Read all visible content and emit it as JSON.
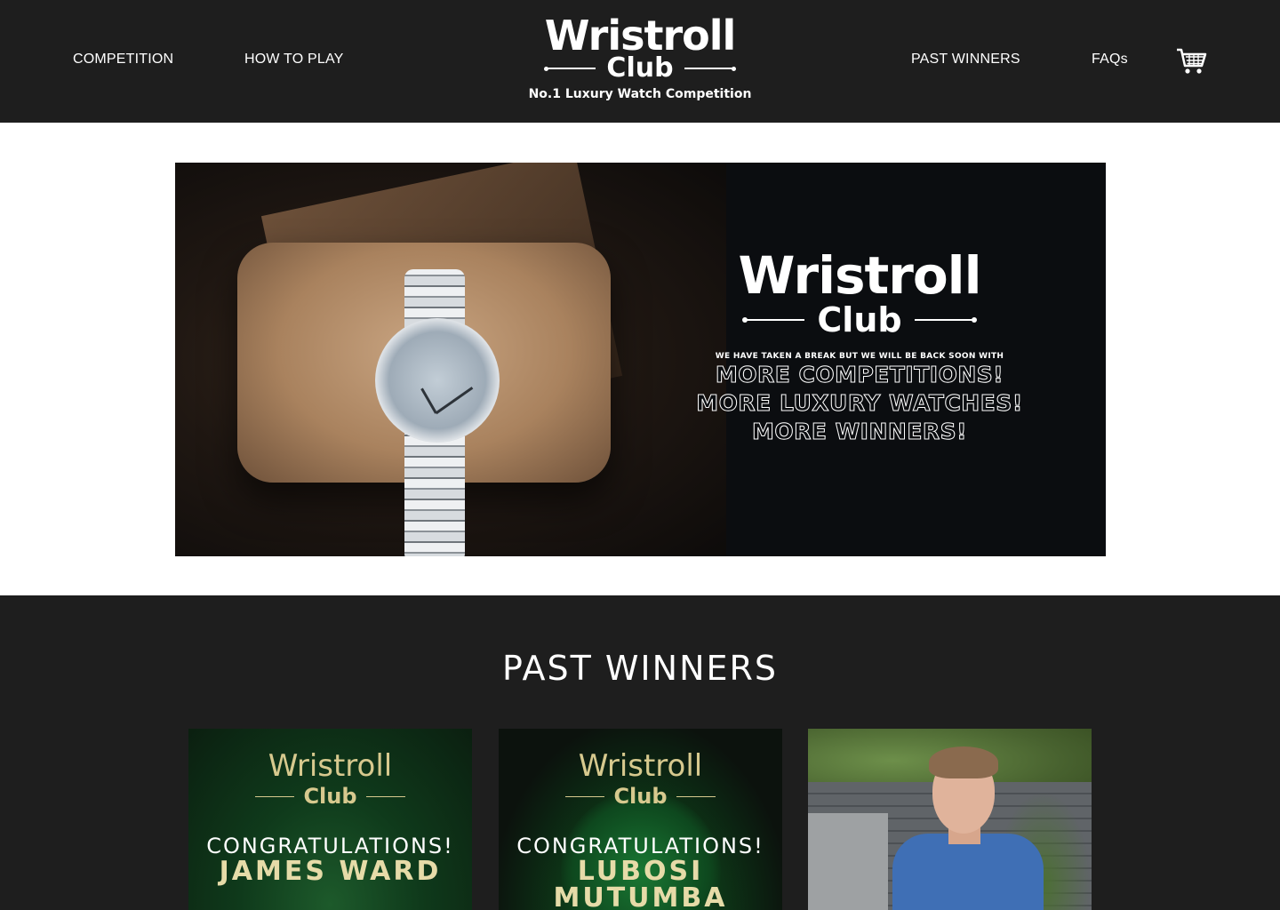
{
  "nav": {
    "competition": "COMPETITION",
    "how_to_play": "HOW TO PLAY",
    "past_winners": "PAST WINNERS",
    "faqs": "FAQs",
    "cart_icon": "shopping-cart-icon"
  },
  "logo": {
    "wordmark": "Wristroll",
    "club": "Club",
    "tagline": "No.1 Luxury Watch Competition"
  },
  "hero": {
    "wordmark": "Wristroll",
    "club": "Club",
    "notice": "WE HAVE TAKEN A BREAK BUT WE WILL BE BACK SOON WITH",
    "line1": "MORE COMPETITIONS!",
    "line2": "MORE LUXURY WATCHES!",
    "line3": "MORE WINNERS!"
  },
  "winners": {
    "heading": "PAST WINNERS",
    "cards": [
      {
        "wordmark": "Wristroll",
        "club": "Club",
        "congrats": "CONGRATULATIONS!",
        "name": "JAMES WARD"
      },
      {
        "wordmark": "Wristroll",
        "club": "Club",
        "congrats": "CONGRATULATIONS!",
        "name": "LUBOSI MUTUMBA"
      }
    ]
  },
  "colors": {
    "header_bg": "#1e1e1e",
    "gold": "#d7c98e",
    "white": "#ffffff"
  }
}
